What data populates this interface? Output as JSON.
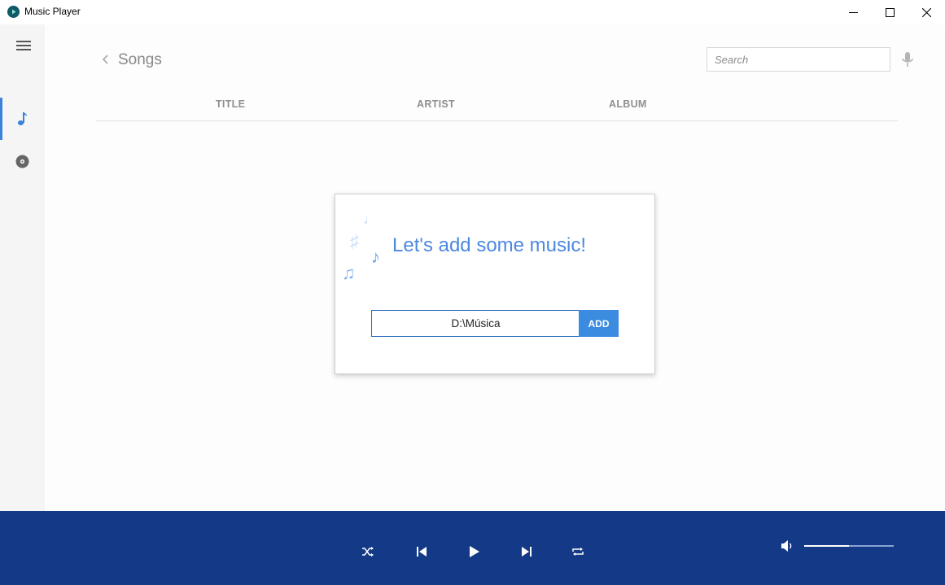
{
  "window": {
    "title": "Music Player",
    "icon": "play-circle-icon",
    "controls": [
      "minimize-icon",
      "maximize-icon",
      "close-icon"
    ]
  },
  "sidebar": {
    "menu_icon": "hamburger-icon",
    "items": [
      {
        "icon": "music-note-icon",
        "active": true
      },
      {
        "icon": "disc-icon",
        "active": false
      }
    ]
  },
  "header": {
    "back_icon": "chevron-left-icon",
    "title": "Songs",
    "search_placeholder": "Search",
    "search_value": "",
    "mic_icon": "microphone-icon"
  },
  "table": {
    "columns": [
      "TITLE",
      "ARTIST",
      "ALBUM"
    ]
  },
  "dialog": {
    "heading": "Let's add some music!",
    "folder_value": "D:\\Música",
    "add_label": "ADD"
  },
  "player": {
    "controls": [
      "shuffle-icon",
      "previous-icon",
      "play-icon",
      "next-icon",
      "repeat-icon"
    ],
    "volume_icon": "volume-icon",
    "volume_level": 0.5
  },
  "colors": {
    "accent": "#3b82d9",
    "player_bar": "#143a87",
    "heading": "#4b88df",
    "add_button": "#3b8be0"
  }
}
